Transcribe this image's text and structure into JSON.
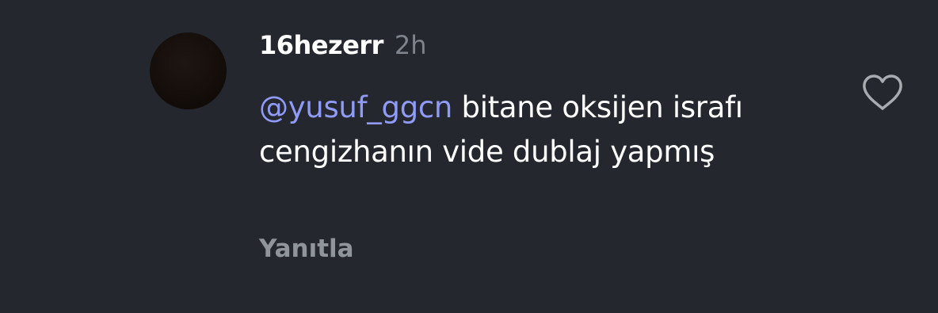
{
  "comment": {
    "username": "16hezerr",
    "timestamp": "2h",
    "mention": "yusuf_ggcn",
    "mention_icon": "@",
    "text": " bitane oksijen israfı cengizhanın vide dublaj yapmış",
    "reply_label": "Yanıtla"
  },
  "icons": {
    "like": "heart-outline-icon"
  },
  "colors": {
    "background": "#24272e",
    "mention": "#8f9bf6",
    "muted": "#7f848c"
  }
}
